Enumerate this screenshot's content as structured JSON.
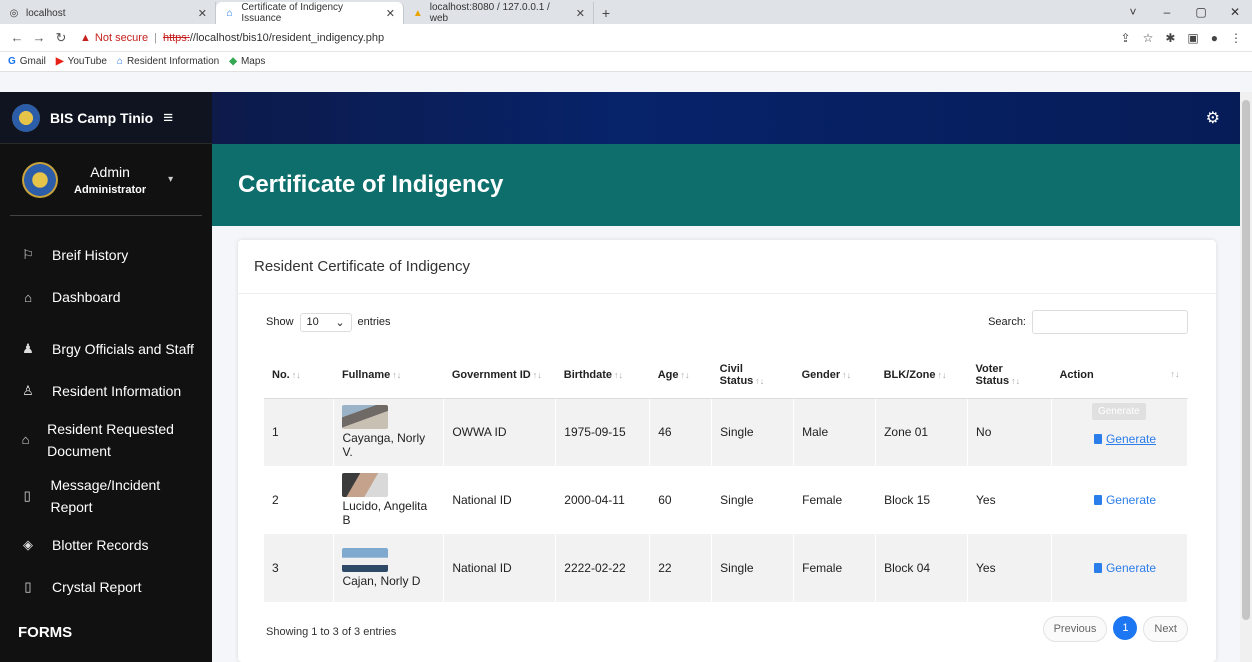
{
  "browser": {
    "tabs": [
      {
        "title": "localhost",
        "icon": "globe-icon",
        "active": false
      },
      {
        "title": "Certificate of Indigency Issuance",
        "icon": "home-icon",
        "active": true
      },
      {
        "title": "localhost:8080 / 127.0.0.1 / web",
        "icon": "phpmyadmin-icon",
        "active": false
      }
    ],
    "new_tab": "+",
    "window_controls": [
      "˅",
      "–",
      "▢",
      "✕"
    ],
    "address": {
      "warning": "Not secure",
      "sep": "|",
      "scheme": "https:",
      "path": "//localhost/bis10/resident_indigency.php"
    },
    "bookmarks": [
      {
        "label": "Gmail",
        "icon": "G"
      },
      {
        "label": "YouTube",
        "icon": "▶"
      },
      {
        "label": "Resident Information",
        "icon": "⌂"
      },
      {
        "label": "Maps",
        "icon": "◆"
      }
    ]
  },
  "sidebar": {
    "brand": "BIS Camp Tinio",
    "burger": "≡",
    "user": {
      "name": "Admin",
      "role": "Administrator",
      "caret": "▾"
    },
    "items": [
      {
        "label": "Breif History",
        "icon": "⚐"
      },
      {
        "label": "Dashboard",
        "icon": "⌂"
      },
      {
        "label": "Brgy Officials and Staff",
        "icon": "♟"
      },
      {
        "label": "Resident Information",
        "icon": "♙"
      },
      {
        "label": "Resident Requested Document",
        "icon": "⌂"
      },
      {
        "label": "Message/Incident Report",
        "icon": "▯"
      },
      {
        "label": "Blotter Records",
        "icon": "◈"
      },
      {
        "label": "Crystal Report",
        "icon": "▯"
      }
    ],
    "forms_header": "FORMS"
  },
  "topnav": {
    "gear": "⚙"
  },
  "page": {
    "title": "Certificate of Indigency"
  },
  "card": {
    "title": "Resident Certificate of Indigency",
    "show_label": "Show",
    "entries_value": "10",
    "entries_label": "entries",
    "search_label": "Search:",
    "search_value": "",
    "columns": [
      "No.",
      "Fullname",
      "Government ID",
      "Birthdate",
      "Age",
      "Civil Status",
      "Gender",
      "BLK/Zone",
      "Voter Status",
      "Action"
    ],
    "rows": [
      {
        "no": "1",
        "fullname": "Cayanga, Norly V.",
        "govid": "OWWA ID",
        "birthdate": "1975-09-15",
        "age": "46",
        "civil": "Single",
        "gender": "Male",
        "zone": "Zone 01",
        "voter": "No",
        "action": "Generate"
      },
      {
        "no": "2",
        "fullname": "Lucido, Angelita B",
        "govid": "National ID",
        "birthdate": "2000-04-11",
        "age": "60",
        "civil": "Single",
        "gender": "Female",
        "zone": "Block 15",
        "voter": "Yes",
        "action": "Generate"
      },
      {
        "no": "3",
        "fullname": "Cajan, Norly D",
        "govid": "National ID",
        "birthdate": "2222-02-22",
        "age": "22",
        "civil": "Single",
        "gender": "Female",
        "zone": "Block 04",
        "voter": "Yes",
        "action": "Generate"
      }
    ],
    "tooltip": "Generate",
    "info": "Showing 1 to 3 of 3 entries",
    "pager": {
      "previous": "Previous",
      "current": "1",
      "next": "Next"
    }
  }
}
